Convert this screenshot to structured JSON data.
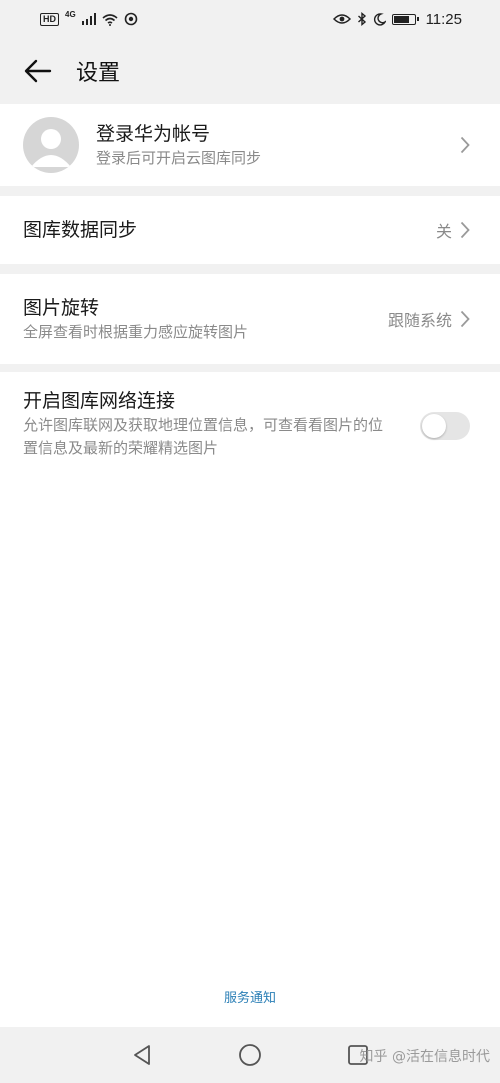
{
  "status": {
    "time": "11:25",
    "hd": "HD",
    "network": "4G"
  },
  "header": {
    "title": "设置"
  },
  "account": {
    "title": "登录华为帐号",
    "subtitle": "登录后可开启云图库同步"
  },
  "settings": [
    {
      "title": "图库数据同步",
      "value": "关"
    },
    {
      "title": "图片旋转",
      "subtitle": "全屏查看时根据重力感应旋转图片",
      "value": "跟随系统"
    },
    {
      "title": "开启图库网络连接",
      "subtitle": "允许图库联网及获取地理位置信息，可查看看图片的位置信息及最新的荣耀精选图片",
      "toggle_on": false
    }
  ],
  "footer": {
    "link": "服务通知"
  },
  "watermark": "知乎 @活在信息时代",
  "colors": {
    "background": "#f1f1f1",
    "card": "#ffffff",
    "link": "#2b7fb6",
    "secondary_text": "#8a8a8a"
  }
}
